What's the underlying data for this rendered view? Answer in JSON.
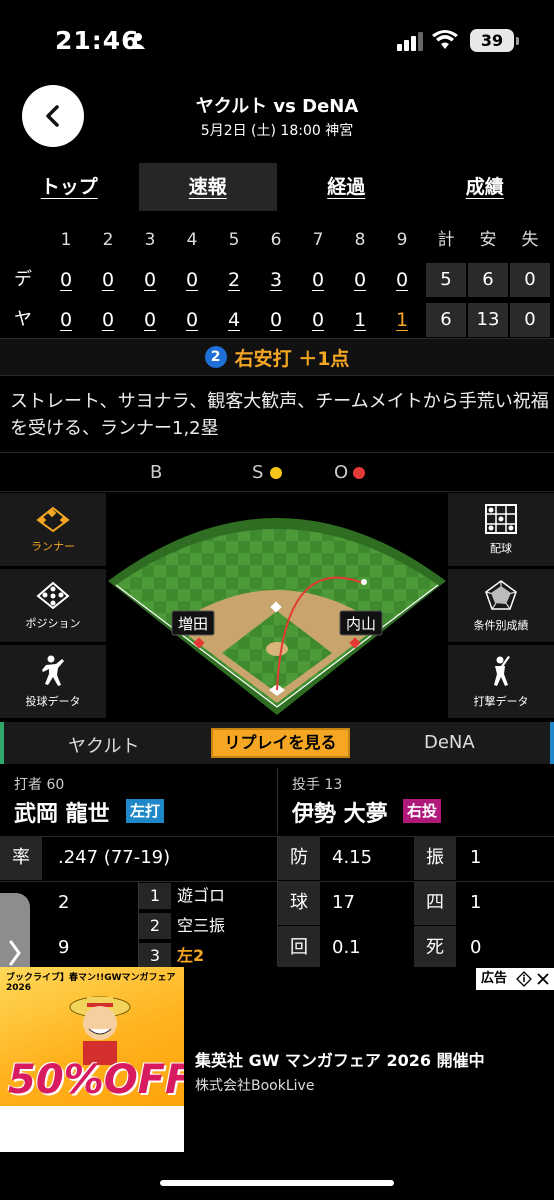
{
  "status": {
    "time": "21:46",
    "battery": "39"
  },
  "header": {
    "title": "ヤクルト vs DeNA",
    "subtitle": "5月2日 (土) 18:00 神宮"
  },
  "tabs": [
    "トップ",
    "速報",
    "経過",
    "成績"
  ],
  "active_tab": "速報",
  "scoreboard": {
    "innings": [
      "1",
      "2",
      "3",
      "4",
      "5",
      "6",
      "7",
      "8",
      "9"
    ],
    "total_headers": [
      "計",
      "安",
      "失"
    ],
    "rows": [
      {
        "team": "デ",
        "innings": [
          "0",
          "0",
          "0",
          "0",
          "2",
          "3",
          "0",
          "0",
          "0"
        ],
        "totals": [
          "5",
          "6",
          "0"
        ]
      },
      {
        "team": "ヤ",
        "innings": [
          "0",
          "0",
          "0",
          "0",
          "4",
          "0",
          "0",
          "1",
          "1"
        ],
        "totals": [
          "6",
          "13",
          "0"
        ]
      }
    ]
  },
  "play": {
    "number": "2",
    "text": "右安打 ＋1点"
  },
  "description": "ストレート、サヨナラ、観客大歓声、チームメイトから手荒い祝福を受ける、ランナー1,2塁",
  "count": {
    "b": "B",
    "s": "S",
    "o": "O"
  },
  "count_colors": {
    "strike": "#f5c518",
    "out": "#e53935"
  },
  "side_menu": {
    "left": [
      "ランナー",
      "ポジション",
      "投球データ"
    ],
    "right": [
      "配球",
      "条件別成績",
      "打撃データ"
    ]
  },
  "field_labels": {
    "left": "増田",
    "right": "内山"
  },
  "teambar": {
    "home": "ヤクルト",
    "replay": "リプレイを見る",
    "away": "DeNA"
  },
  "batter": {
    "info": "打者 60",
    "name": "武岡 龍世",
    "badge": "左打"
  },
  "pitcher": {
    "info": "投手 13",
    "name": "伊勢 大夢",
    "badge": "右投"
  },
  "stats": {
    "rate_label": "率",
    "rate_value": ".247 (77-19)",
    "batter_rows": [
      "2",
      "9"
    ],
    "at_bats": [
      {
        "n": "1",
        "r": "遊ゴロ"
      },
      {
        "n": "2",
        "r": "空三振"
      },
      {
        "n": "3",
        "r": "左2"
      }
    ],
    "pitcher": [
      {
        "label": "防",
        "value": "4.15",
        "label2": "振",
        "value2": "1"
      },
      {
        "label": "球",
        "value": "17",
        "label2": "四",
        "value2": "1"
      },
      {
        "label": "回",
        "value": "0.1",
        "label2": "死",
        "value2": "0"
      }
    ]
  },
  "ad": {
    "label": "広告",
    "headline": "ブックライブ】春マン!!GWマンガフェア2026",
    "discount": "50%OFF",
    "title": "集英社 GW マンガフェア 2026 開催中",
    "brand": "株式会社BookLive"
  },
  "colors": {
    "accent": "#f5a623",
    "home": "#2ea86b",
    "away": "#1e88c8"
  }
}
